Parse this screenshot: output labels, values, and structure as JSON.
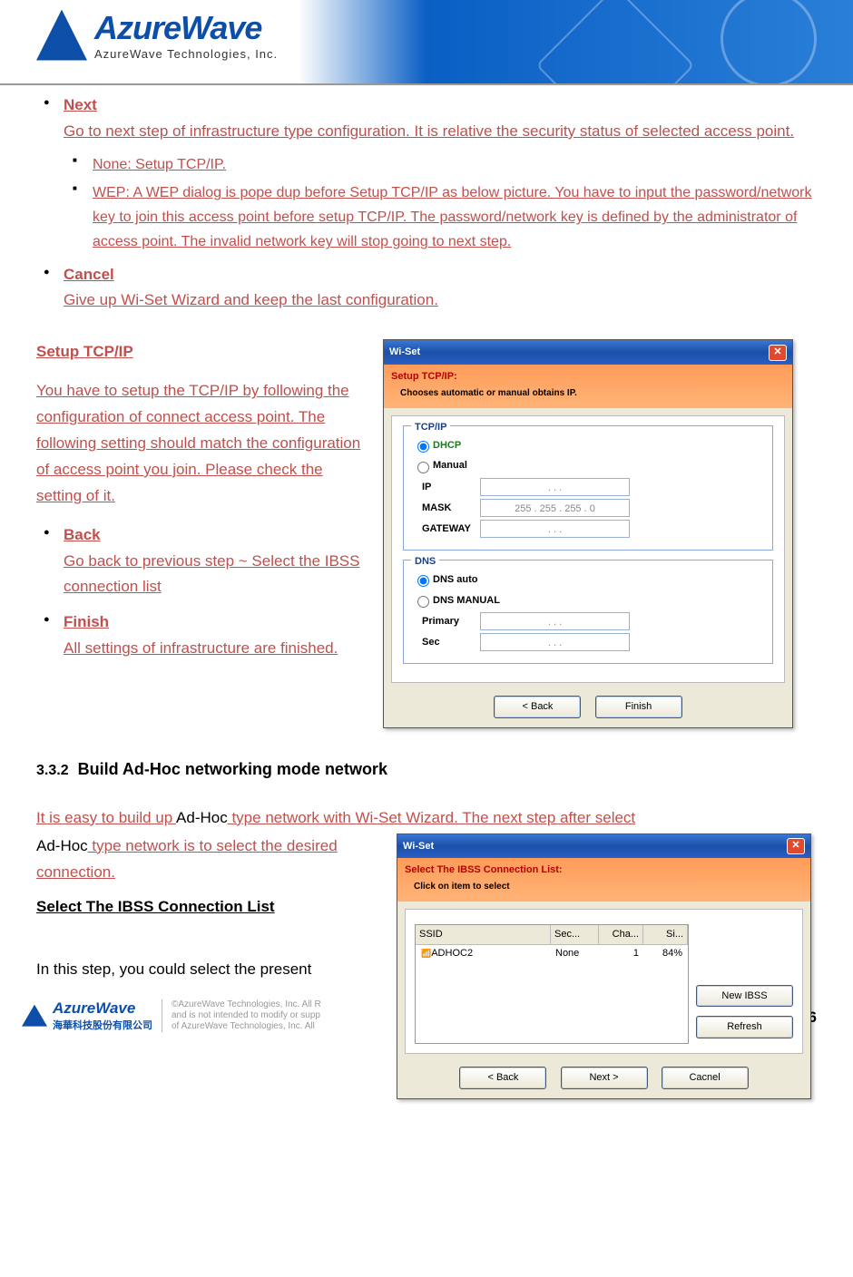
{
  "header": {
    "brand": "AzureWave",
    "tagline": "AzureWave  Technologies,  Inc."
  },
  "bullets": {
    "next": {
      "term": "Next",
      "desc": "Go to next step of infrastructure type configuration. It is relative the security status of selected access point.",
      "sub": {
        "none": "None: Setup TCP/IP.",
        "wep": "WEP: A WEP dialog is pope dup before Setup TCP/IP as below picture. You have to input the password/network key to join this access point before setup TCP/IP. The password/network key is defined by the administrator of access point. The invalid network key will stop going to next step."
      }
    },
    "cancel": {
      "term": "Cancel",
      "desc": "Give up Wi-Set Wizard and keep the last configuration."
    }
  },
  "setup": {
    "heading": "Setup TCP/IP",
    "para": "You have to setup the TCP/IP by following the configuration of connect access point. The following setting should match the configuration of access point you join. Please check the setting of it.",
    "back": {
      "term": "Back",
      "desc": "Go back to previous step ~ Select the IBSS connection list"
    },
    "finish": {
      "term": "Finish",
      "desc": "All settings of infrastructure are finished."
    }
  },
  "dialog1": {
    "title": "Wi-Set",
    "subtitle": "Setup TCP/IP:",
    "subtitle2": "Chooses automatic or manual obtains IP.",
    "group_tcpip": "TCP/IP",
    "radio_dhcp": "DHCP",
    "radio_manual": "Manual",
    "label_ip": "IP",
    "label_mask": "MASK",
    "label_gateway": "GATEWAY",
    "mask_value": "255  .  255  .  255  .    0",
    "ip_placeholder": ".          .          .",
    "group_dns": "DNS",
    "radio_dns_auto": "DNS auto",
    "radio_dns_manual": "DNS MANUAL",
    "label_primary": "Primary",
    "label_sec": "Sec",
    "btn_back": "< Back",
    "btn_finish": "Finish"
  },
  "section332": {
    "num": "3.3.2",
    "title": "Build Ad-Hoc networking mode network",
    "para_pre": "It is easy to build up ",
    "adhoc1": "Ad-Hoc",
    "para_mid": " type network with Wi-Set Wizard. The next step after select ",
    "adhoc2": "Ad-Hoc",
    "para_post": " type network is to select the desired connection.",
    "list_heading": "Select The IBSS Connection List",
    "last_line": "In this step, you could select the present"
  },
  "dialog2": {
    "title": "Wi-Set",
    "subtitle": "Select The IBSS Connection List:",
    "subtitle2": "Click on item to select",
    "col_ssid": "SSID",
    "col_sec": "Sec...",
    "col_cha": "Cha...",
    "col_si": "Si...",
    "row_ssid": "ADHOC2",
    "row_sec": "None",
    "row_cha": "1",
    "row_si": "84%",
    "btn_new": "New IBSS",
    "btn_refresh": "Refresh",
    "btn_back": "< Back",
    "btn_next": "Next >",
    "btn_cancel": "Cacnel"
  },
  "footer": {
    "brand": "AzureWave",
    "brand_cn": "海華科技股份有限公司",
    "legal1": "©AzureWave Technologies, Inc. All R",
    "legal2": "and is not intended to modify or supp",
    "legal3": "of AzureWave Technologies, Inc.  All",
    "page": "-6"
  }
}
